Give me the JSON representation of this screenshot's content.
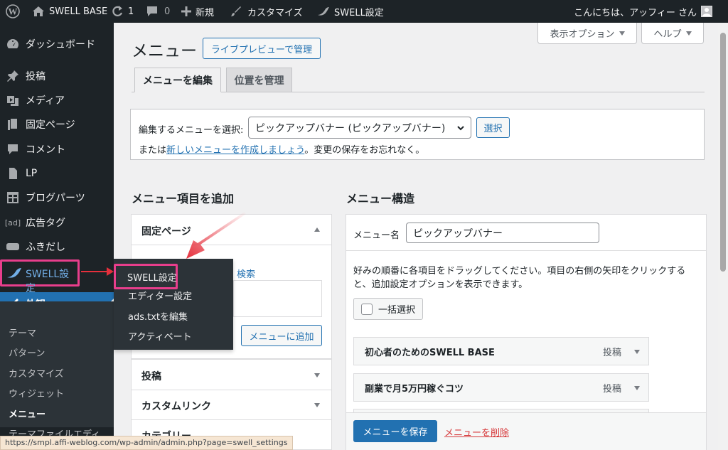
{
  "admin_bar": {
    "site_name": "SWELL BASE",
    "updates_count": "1",
    "comments_count": "0",
    "new_label": "新規",
    "customize_label": "カスタマイズ",
    "swell_label": "SWELL設定",
    "greeting": "こんにちは、アッフィー さん"
  },
  "sidebar": {
    "items": [
      {
        "label": "ダッシュボード",
        "icon": "dashboard-icon"
      },
      {
        "label": "投稿",
        "icon": "pin-icon"
      },
      {
        "label": "メディア",
        "icon": "media-icon"
      },
      {
        "label": "固定ページ",
        "icon": "page-icon"
      },
      {
        "label": "コメント",
        "icon": "comment-icon"
      },
      {
        "label": "LP",
        "icon": "document-icon"
      },
      {
        "label": "ブログパーツ",
        "icon": "grid-icon"
      },
      {
        "label": "広告タグ",
        "icon": "ad-icon"
      },
      {
        "label": "ふきだし",
        "icon": "bubble-icon"
      },
      {
        "label": "SWELL設定",
        "icon": "swell-icon"
      },
      {
        "label": "外観",
        "icon": "brush-icon"
      }
    ],
    "ad_icon_text": "[ad]",
    "submenu": [
      "テーマ",
      "パターン",
      "カスタマイズ",
      "ウィジェット",
      "メニュー",
      "テーマファイルエディ"
    ]
  },
  "flyout": {
    "items": [
      "SWELL設定",
      "エディター設定",
      "ads.txtを編集",
      "アクティベート"
    ]
  },
  "header": {
    "title": "メニュー",
    "live_preview_button": "ライブプレビューで管理",
    "screen_options": "表示オプション",
    "help": "ヘルプ"
  },
  "tabs": [
    "メニューを編集",
    "位置を管理"
  ],
  "select_menu": {
    "label": "編集するメニューを選択:",
    "selected": "ピックアップバナー (ピックアップバナー)",
    "select_button": "選択",
    "note_prefix": "または",
    "note_link": "新しいメニューを作成しましょう",
    "note_suffix": "。変更の保存をお忘れなく。"
  },
  "add_items": {
    "heading": "メニュー項目を追加",
    "sections": [
      "固定ページ",
      "投稿",
      "カスタムリンク",
      "カテゴリー"
    ],
    "search_label": "検索",
    "add_button": "メニューに追加"
  },
  "structure": {
    "heading": "メニュー構造",
    "name_label": "メニュー名",
    "name_value": "ピックアップバナー",
    "instructions_line1": "好みの順番に各項目をドラッグしてください。項目の右側の矢印をクリックする",
    "instructions_line2": "と、追加設定オプションを表示できます。",
    "bulk_select": "一括選択",
    "items": [
      {
        "title": "初心者のためのSWELL BASE",
        "type": "投稿"
      },
      {
        "title": "副業で月5万円稼ぐコツ",
        "type": "投稿"
      }
    ],
    "save_button": "メニューを保存",
    "delete_link": "メニューを削除"
  },
  "status_bar": {
    "url": "https://smpl.affi-weblog.com/wp-admin/admin.php?page=swell_settings"
  },
  "colors": {
    "accent": "#2271b1",
    "highlight": "#e83e8c",
    "arrow": "#e5303c",
    "adminbar": "#1d2327"
  }
}
